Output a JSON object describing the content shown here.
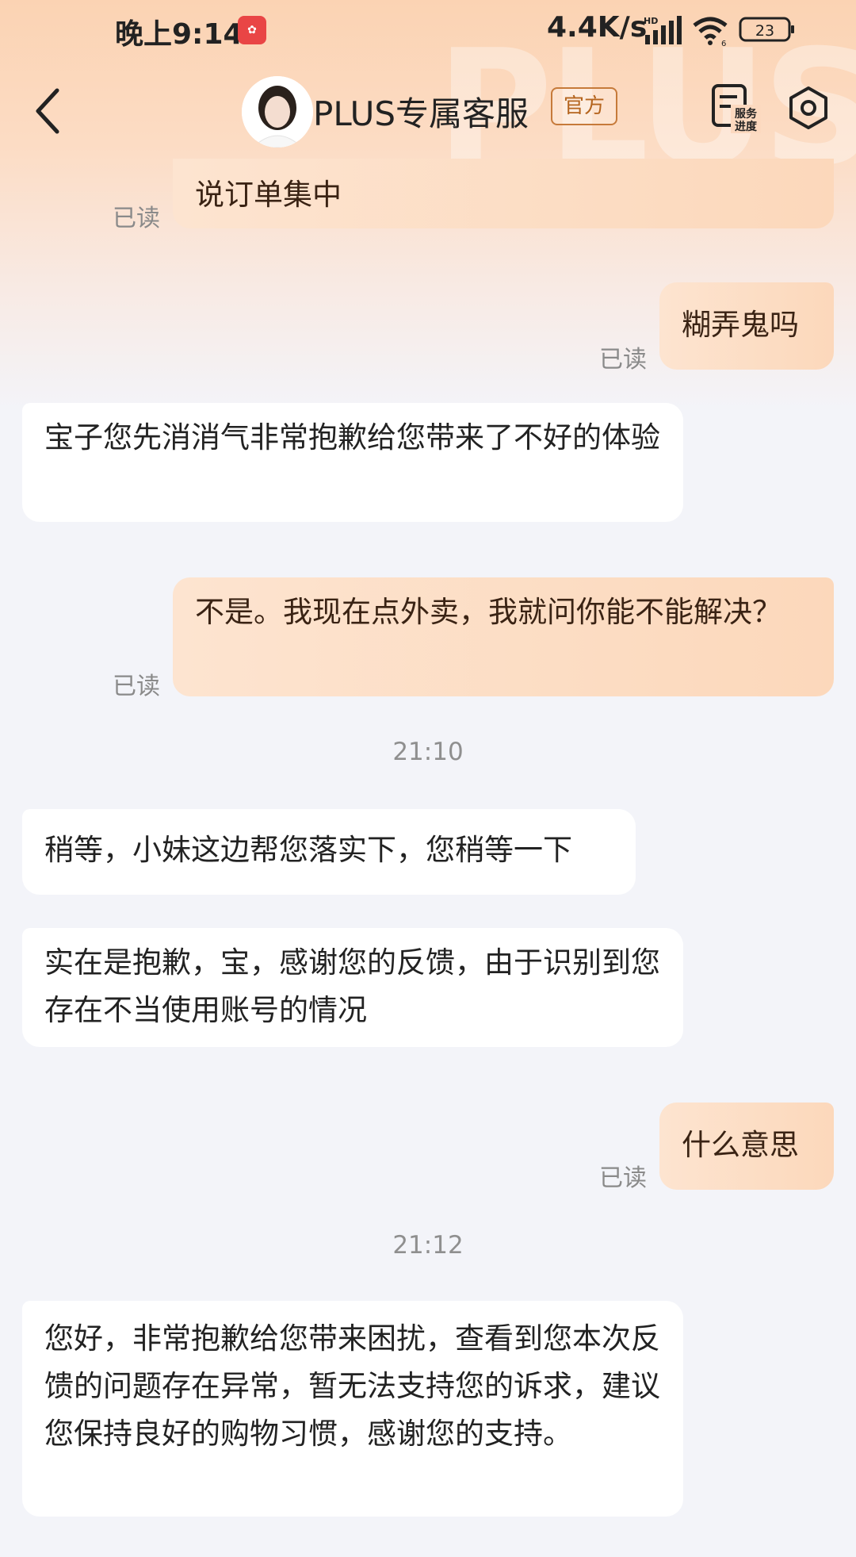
{
  "status_bar": {
    "time": "晚上9:14",
    "app_icon": "notification-app-icon",
    "network_speed": "4.4K/s",
    "signal_label": "HD",
    "battery": "23"
  },
  "header": {
    "title": "PLUS专属客服",
    "badge": "官方",
    "progress_line1": "服务",
    "progress_line2": "进度",
    "watermark": "PLUS"
  },
  "messages": [
    {
      "side": "out",
      "text": "说订单集中",
      "status": "已读"
    },
    {
      "side": "out",
      "text": "糊弄鬼吗",
      "status": "已读"
    },
    {
      "side": "in",
      "text": "宝子您先消消气非常抱歉给您带来了不好的体验"
    },
    {
      "side": "out",
      "text": "不是。我现在点外卖，我就问你能不能解决？",
      "status": "已读"
    },
    {
      "side": "time",
      "text": "21:10"
    },
    {
      "side": "in",
      "text": "稍等，小妹这边帮您落实下，您稍等一下"
    },
    {
      "side": "in",
      "text": "实在是抱歉，宝，感谢您的反馈，由于识别到您存在不当使用账号的情况"
    },
    {
      "side": "out",
      "text": "什么意思",
      "status": "已读"
    },
    {
      "side": "time",
      "text": "21:12"
    },
    {
      "side": "in",
      "text": "您好，非常抱歉给您带来困扰，查看到您本次反馈的问题存在异常，暂无法支持您的诉求，建议您保持良好的购物习惯，感谢您的支持。"
    }
  ],
  "colors": {
    "outgoing_bubble": "#fcd8bb",
    "incoming_bubble": "#ffffff",
    "background": "#f3f4f9",
    "badge_border": "#c67a3a"
  }
}
